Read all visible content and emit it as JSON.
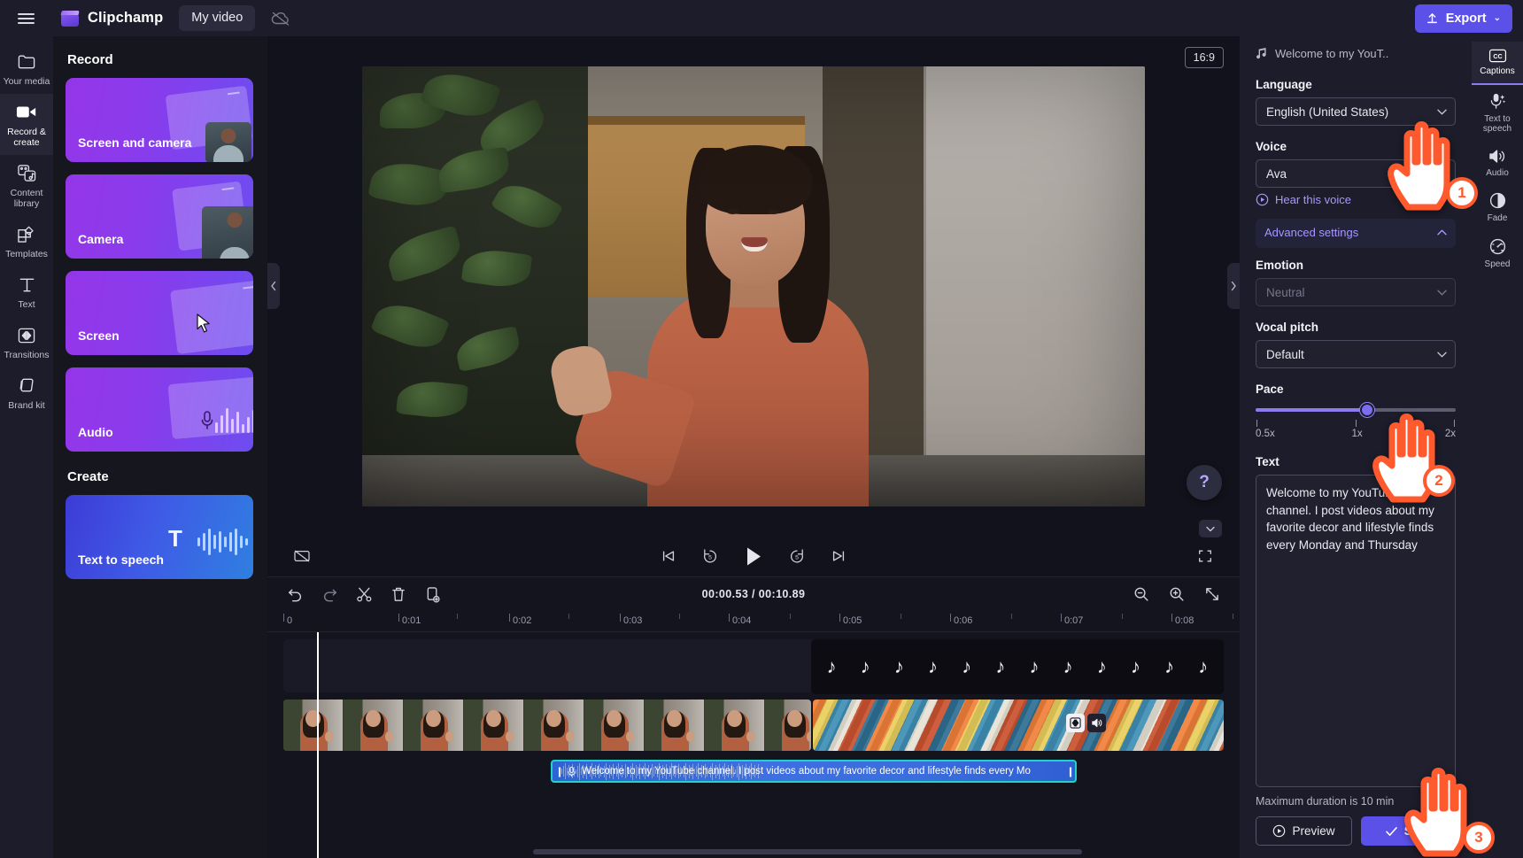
{
  "topbar": {
    "menu_icon": "hamburger-icon",
    "brand": "Clipchamp",
    "project_tab": "My video",
    "cloud_icon": "cloud-off-icon",
    "export_label": "Export",
    "export_caret": "⌄"
  },
  "left_rail": {
    "items": [
      {
        "label": "Your media",
        "icon": "folder-icon",
        "active": false
      },
      {
        "label": "Record & create",
        "icon": "video-camera-icon",
        "active": true
      },
      {
        "label": "Content library",
        "icon": "content-library-icon",
        "active": false
      },
      {
        "label": "Templates",
        "icon": "templates-icon",
        "active": false
      },
      {
        "label": "Text",
        "icon": "text-icon",
        "active": false
      },
      {
        "label": "Transitions",
        "icon": "transitions-icon",
        "active": false
      },
      {
        "label": "Brand kit",
        "icon": "brand-kit-icon",
        "active": false
      }
    ]
  },
  "record_panel": {
    "record_heading": "Record",
    "cards": [
      {
        "label": "Screen and camera",
        "art": "screen-camera"
      },
      {
        "label": "Camera",
        "art": "camera"
      },
      {
        "label": "Screen",
        "art": "screen"
      },
      {
        "label": "Audio",
        "art": "audio"
      }
    ],
    "create_heading": "Create",
    "tts_card": {
      "label": "Text to speech"
    }
  },
  "stage": {
    "aspect_ratio": "16:9",
    "help_icon": "help-icon",
    "help_glyph": "?",
    "collapse_left_icon": "chevron-left-icon",
    "collapse_right_icon": "chevron-right-icon",
    "dropdown_caret_icon": "chevron-down-icon"
  },
  "player": {
    "captions_toggle_icon": "captions-off-icon",
    "skip_start_icon": "skip-to-start-icon",
    "rewind_icon": "rewind-5s-icon",
    "rewind_label": "5",
    "play_icon": "play-icon",
    "forward_icon": "forward-5s-icon",
    "forward_label": "5",
    "skip_end_icon": "skip-to-end-icon",
    "fullscreen_icon": "fullscreen-icon"
  },
  "timeline": {
    "tools": [
      {
        "name": "undo-button",
        "icon": "undo-icon"
      },
      {
        "name": "redo-button",
        "icon": "redo-icon"
      },
      {
        "name": "split-button",
        "icon": "scissors-icon"
      },
      {
        "name": "delete-button",
        "icon": "trash-icon"
      },
      {
        "name": "duplicate-button",
        "icon": "duplicate-icon"
      }
    ],
    "current_time": "00:00.53",
    "separator": "/",
    "total_time": "00:10.89",
    "time_display": "00:00.53 / 00:10.89",
    "zoom_out_icon": "zoom-out-icon",
    "zoom_in_icon": "zoom-in-icon",
    "fit_icon": "fit-to-screen-icon",
    "ruler_ticks": [
      "0",
      "0:01",
      "0:02",
      "0:03",
      "0:04",
      "0:05",
      "0:06",
      "0:07",
      "0:08"
    ],
    "audio_clip_label": "Welcome to my YouTube channel. I post videos about my favorite decor and lifestyle finds every Mo",
    "music_note_glyph": "♪",
    "clip_badges": [
      {
        "name": "transition-badge",
        "icon": "transition-icon"
      },
      {
        "name": "volume-badge",
        "icon": "speaker-icon"
      }
    ]
  },
  "properties": {
    "clip_title": "Welcome to my YouT..",
    "clip_title_icon": "music-note-icon",
    "language_label": "Language",
    "language_value": "English (United States)",
    "voice_label": "Voice",
    "voice_value": "Ava",
    "hear_voice_label": "Hear this voice",
    "hear_voice_icon": "play-circle-icon",
    "advanced_settings_label": "Advanced settings",
    "advanced_chevron_icon": "chevron-up-icon",
    "emotion_label": "Emotion",
    "emotion_value": "Neutral",
    "vocal_pitch_label": "Vocal pitch",
    "vocal_pitch_value": "Default",
    "pace_label": "Pace",
    "pace_value": 1,
    "pace_min_label": "0.5x",
    "pace_mid_label": "1x",
    "pace_max_label": "2x",
    "text_label": "Text",
    "text_value": "Welcome to my YouTube channel. I post videos about my favorite decor and lifestyle finds every Monday and Thursday",
    "max_duration_note": "Maximum duration is 10 min",
    "preview_label": "Preview",
    "preview_icon": "play-circle-icon",
    "save_label": "Save",
    "save_icon": "check-icon"
  },
  "right_rail": {
    "items": [
      {
        "label": "Captions",
        "icon": "cc-icon",
        "active": true
      },
      {
        "label": "Text to speech",
        "icon": "tts-mic-icon",
        "active": false
      },
      {
        "label": "Audio",
        "icon": "speaker-icon",
        "active": false
      },
      {
        "label": "Fade",
        "icon": "fade-icon",
        "active": false
      },
      {
        "label": "Speed",
        "icon": "speed-gauge-icon",
        "active": false
      }
    ]
  },
  "annotations": {
    "badges": [
      "1",
      "2",
      "3"
    ]
  },
  "colors": {
    "accent": "#5b50e8",
    "accent_light": "#8b7bf0",
    "link": "#a996ff",
    "annotation": "#ff5a2e",
    "panel_bg": "#1c1c2a",
    "app_bg": "#12121c"
  }
}
